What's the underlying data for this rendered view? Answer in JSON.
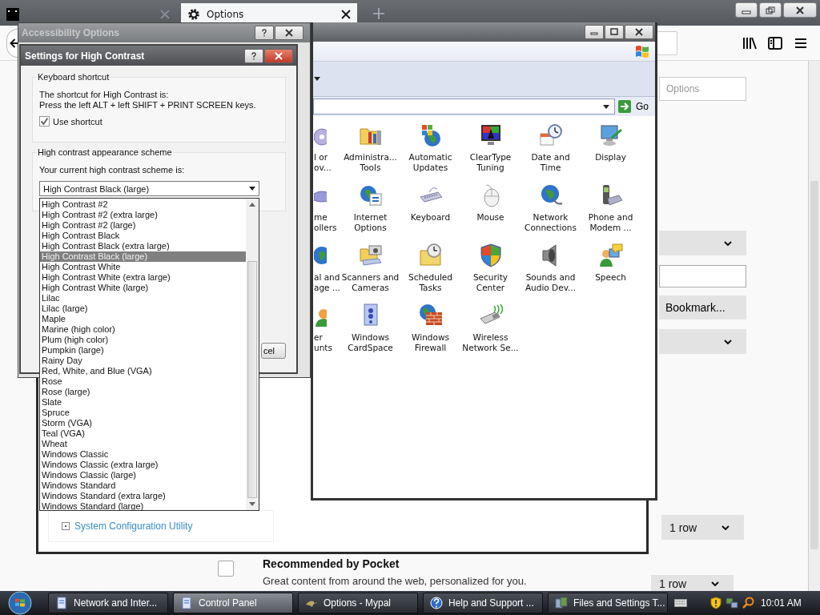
{
  "browser": {
    "tabs": [
      {
        "selected": false
      },
      {
        "label": "Options",
        "selected": true
      }
    ],
    "search": {
      "placeholder": "Options"
    },
    "panel_controls": [
      {
        "kind": "select"
      },
      {
        "kind": "input"
      },
      {
        "kind": "button",
        "label": "Bookmark..."
      },
      {
        "kind": "select"
      }
    ],
    "rows_select": {
      "value": "1 row"
    },
    "pocket": {
      "checked": false,
      "title": "Recommended by Pocket",
      "description": "Great content from around the web, personalized for you.",
      "rows_value": "1 row"
    }
  },
  "help_window": {
    "link": "System Configuration Utility"
  },
  "control_panel": {
    "go_label": "Go",
    "items": [
      {
        "kind": "partial",
        "label": "l or\nov..."
      },
      {
        "kind": "full",
        "label": "Administra...\nTools"
      },
      {
        "kind": "full",
        "label": "Automatic\nUpdates"
      },
      {
        "kind": "full",
        "label": "ClearType\nTuning"
      },
      {
        "kind": "full",
        "label": "Date and\nTime"
      },
      {
        "kind": "full",
        "label": "Display"
      },
      {
        "kind": "partial",
        "label": "me\nollers"
      },
      {
        "kind": "full",
        "label": "Internet\nOptions"
      },
      {
        "kind": "full",
        "label": "Keyboard"
      },
      {
        "kind": "full",
        "label": "Mouse"
      },
      {
        "kind": "full",
        "label": "Network\nConnections"
      },
      {
        "kind": "full",
        "label": "Phone and\nModem ..."
      },
      {
        "kind": "partial",
        "label": "al and\nage ..."
      },
      {
        "kind": "full",
        "label": "Scanners and\nCameras"
      },
      {
        "kind": "full",
        "label": "Scheduled\nTasks"
      },
      {
        "kind": "full",
        "label": "Security\nCenter"
      },
      {
        "kind": "full",
        "label": "Sounds and\nAudio Dev..."
      },
      {
        "kind": "full",
        "label": "Speech"
      },
      {
        "kind": "partial",
        "label": "er\nunts"
      },
      {
        "kind": "full",
        "label": "Windows\nCardSpace"
      },
      {
        "kind": "full",
        "label": "Windows\nFirewall"
      },
      {
        "kind": "full",
        "label": "Wireless\nNetwork Se..."
      }
    ]
  },
  "accessibility_window": {
    "title": "Accessibility Options"
  },
  "high_contrast_dialog": {
    "title": "Settings for High Contrast",
    "shortcut_group": "Keyboard shortcut",
    "shortcut_text": "The shortcut for High Contrast is:\nPress the left ALT + left SHIFT + PRINT SCREEN keys.",
    "use_shortcut": {
      "label": "Use shortcut",
      "checked": true
    },
    "scheme_group": "High contrast appearance scheme",
    "scheme_label": "Your current high contrast scheme is:",
    "scheme_value": "High Contrast Black (large)",
    "cancel_label": "cel",
    "schemes": [
      {
        "label": "High Contrast #2",
        "selected": false
      },
      {
        "label": "High Contrast #2 (extra large)",
        "selected": false
      },
      {
        "label": "High Contrast #2 (large)",
        "selected": false
      },
      {
        "label": "High Contrast Black",
        "selected": false
      },
      {
        "label": "High Contrast Black (extra large)",
        "selected": false
      },
      {
        "label": "High Contrast Black (large)",
        "selected": true
      },
      {
        "label": "High Contrast White",
        "selected": false
      },
      {
        "label": "High Contrast White (extra large)",
        "selected": false
      },
      {
        "label": "High Contrast White (large)",
        "selected": false
      },
      {
        "label": "Lilac",
        "selected": false
      },
      {
        "label": "Lilac (large)",
        "selected": false
      },
      {
        "label": "Maple",
        "selected": false
      },
      {
        "label": "Marine (high color)",
        "selected": false
      },
      {
        "label": "Plum (high color)",
        "selected": false
      },
      {
        "label": "Pumpkin (large)",
        "selected": false
      },
      {
        "label": "Rainy Day",
        "selected": false
      },
      {
        "label": "Red, White, and Blue (VGA)",
        "selected": false
      },
      {
        "label": "Rose",
        "selected": false
      },
      {
        "label": "Rose (large)",
        "selected": false
      },
      {
        "label": "Slate",
        "selected": false
      },
      {
        "label": "Spruce",
        "selected": false
      },
      {
        "label": "Storm (VGA)",
        "selected": false
      },
      {
        "label": "Teal (VGA)",
        "selected": false
      },
      {
        "label": "Wheat",
        "selected": false
      },
      {
        "label": "Windows Classic",
        "selected": false
      },
      {
        "label": "Windows Classic (extra large)",
        "selected": false
      },
      {
        "label": "Windows Classic (large)",
        "selected": false
      },
      {
        "label": "Windows Standard",
        "selected": false
      },
      {
        "label": "Windows Standard (extra large)",
        "selected": false
      },
      {
        "label": "Windows Standard (large)",
        "selected": false
      }
    ]
  },
  "taskbar": {
    "buttons": [
      {
        "label": "Network and Inter...",
        "selected": false
      },
      {
        "label": "Control Panel",
        "selected": true
      },
      {
        "label": "Options - Mypal",
        "selected": false
      },
      {
        "label": "Help and Support ...",
        "selected": false
      },
      {
        "label": "Files and Settings T...",
        "selected": false
      }
    ],
    "clock": "10:01 AM"
  }
}
